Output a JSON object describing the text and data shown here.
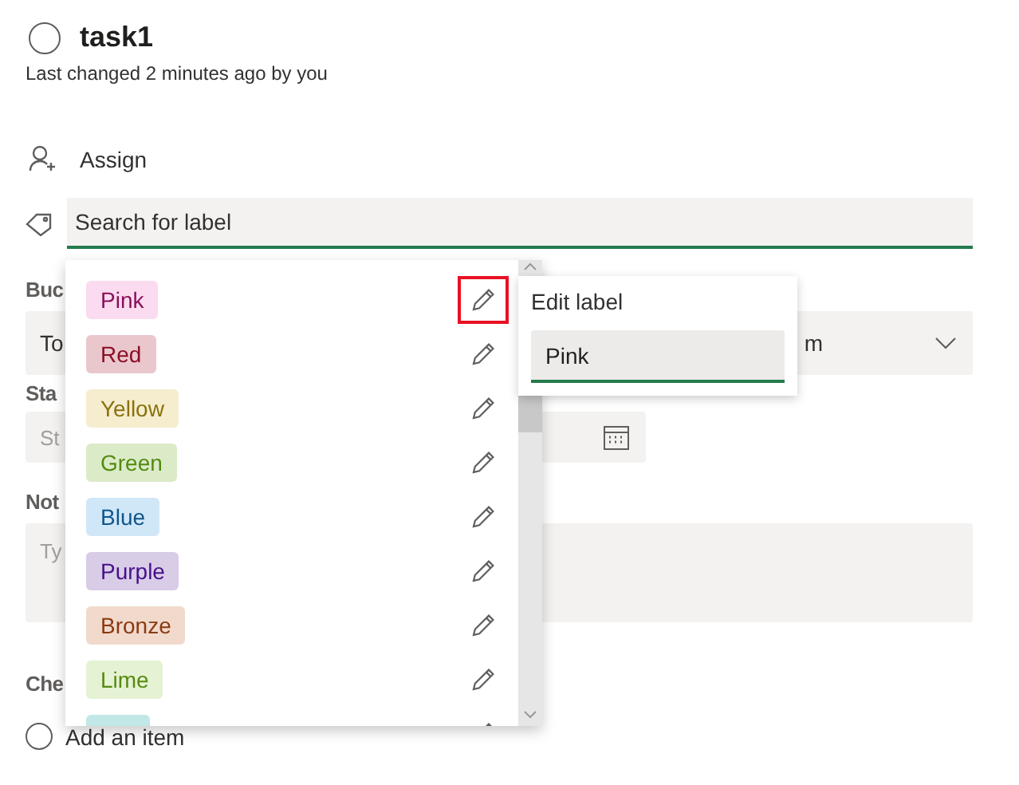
{
  "task": {
    "title": "task1",
    "status": "Last changed 2 minutes ago by you",
    "completed": false
  },
  "assign": {
    "label": "Assign"
  },
  "label_search": {
    "placeholder": "Search for label"
  },
  "bucket": {
    "label": "Buc",
    "value": "To"
  },
  "priority": {
    "value": "m"
  },
  "start_date": {
    "label": "Sta",
    "placeholder": "St"
  },
  "notes": {
    "label": "Not",
    "placeholder": "Ty"
  },
  "checklist": {
    "label": "Che",
    "add_item": "Add an item",
    "checked": false
  },
  "label_menu": {
    "items": [
      {
        "name": "Pink",
        "color": "#fbdbef",
        "editing": true
      },
      {
        "name": "Red",
        "color": "#e9c7cd",
        "editing": false
      },
      {
        "name": "Yellow",
        "color": "#f5edce",
        "editing": false
      },
      {
        "name": "Green",
        "color": "#dbebc7",
        "editing": false
      },
      {
        "name": "Blue",
        "color": "#d0e7f8",
        "editing": false
      },
      {
        "name": "Purple",
        "color": "#d8cce7",
        "editing": false
      },
      {
        "name": "Bronze",
        "color": "#f1d9cc",
        "editing": false
      },
      {
        "name": "Lime",
        "color": "#e5f2d3",
        "editing": false
      },
      {
        "color": "#c2e7e7",
        "editing": false
      }
    ]
  },
  "edit_popup": {
    "title": "Edit label",
    "value": "Pink"
  }
}
